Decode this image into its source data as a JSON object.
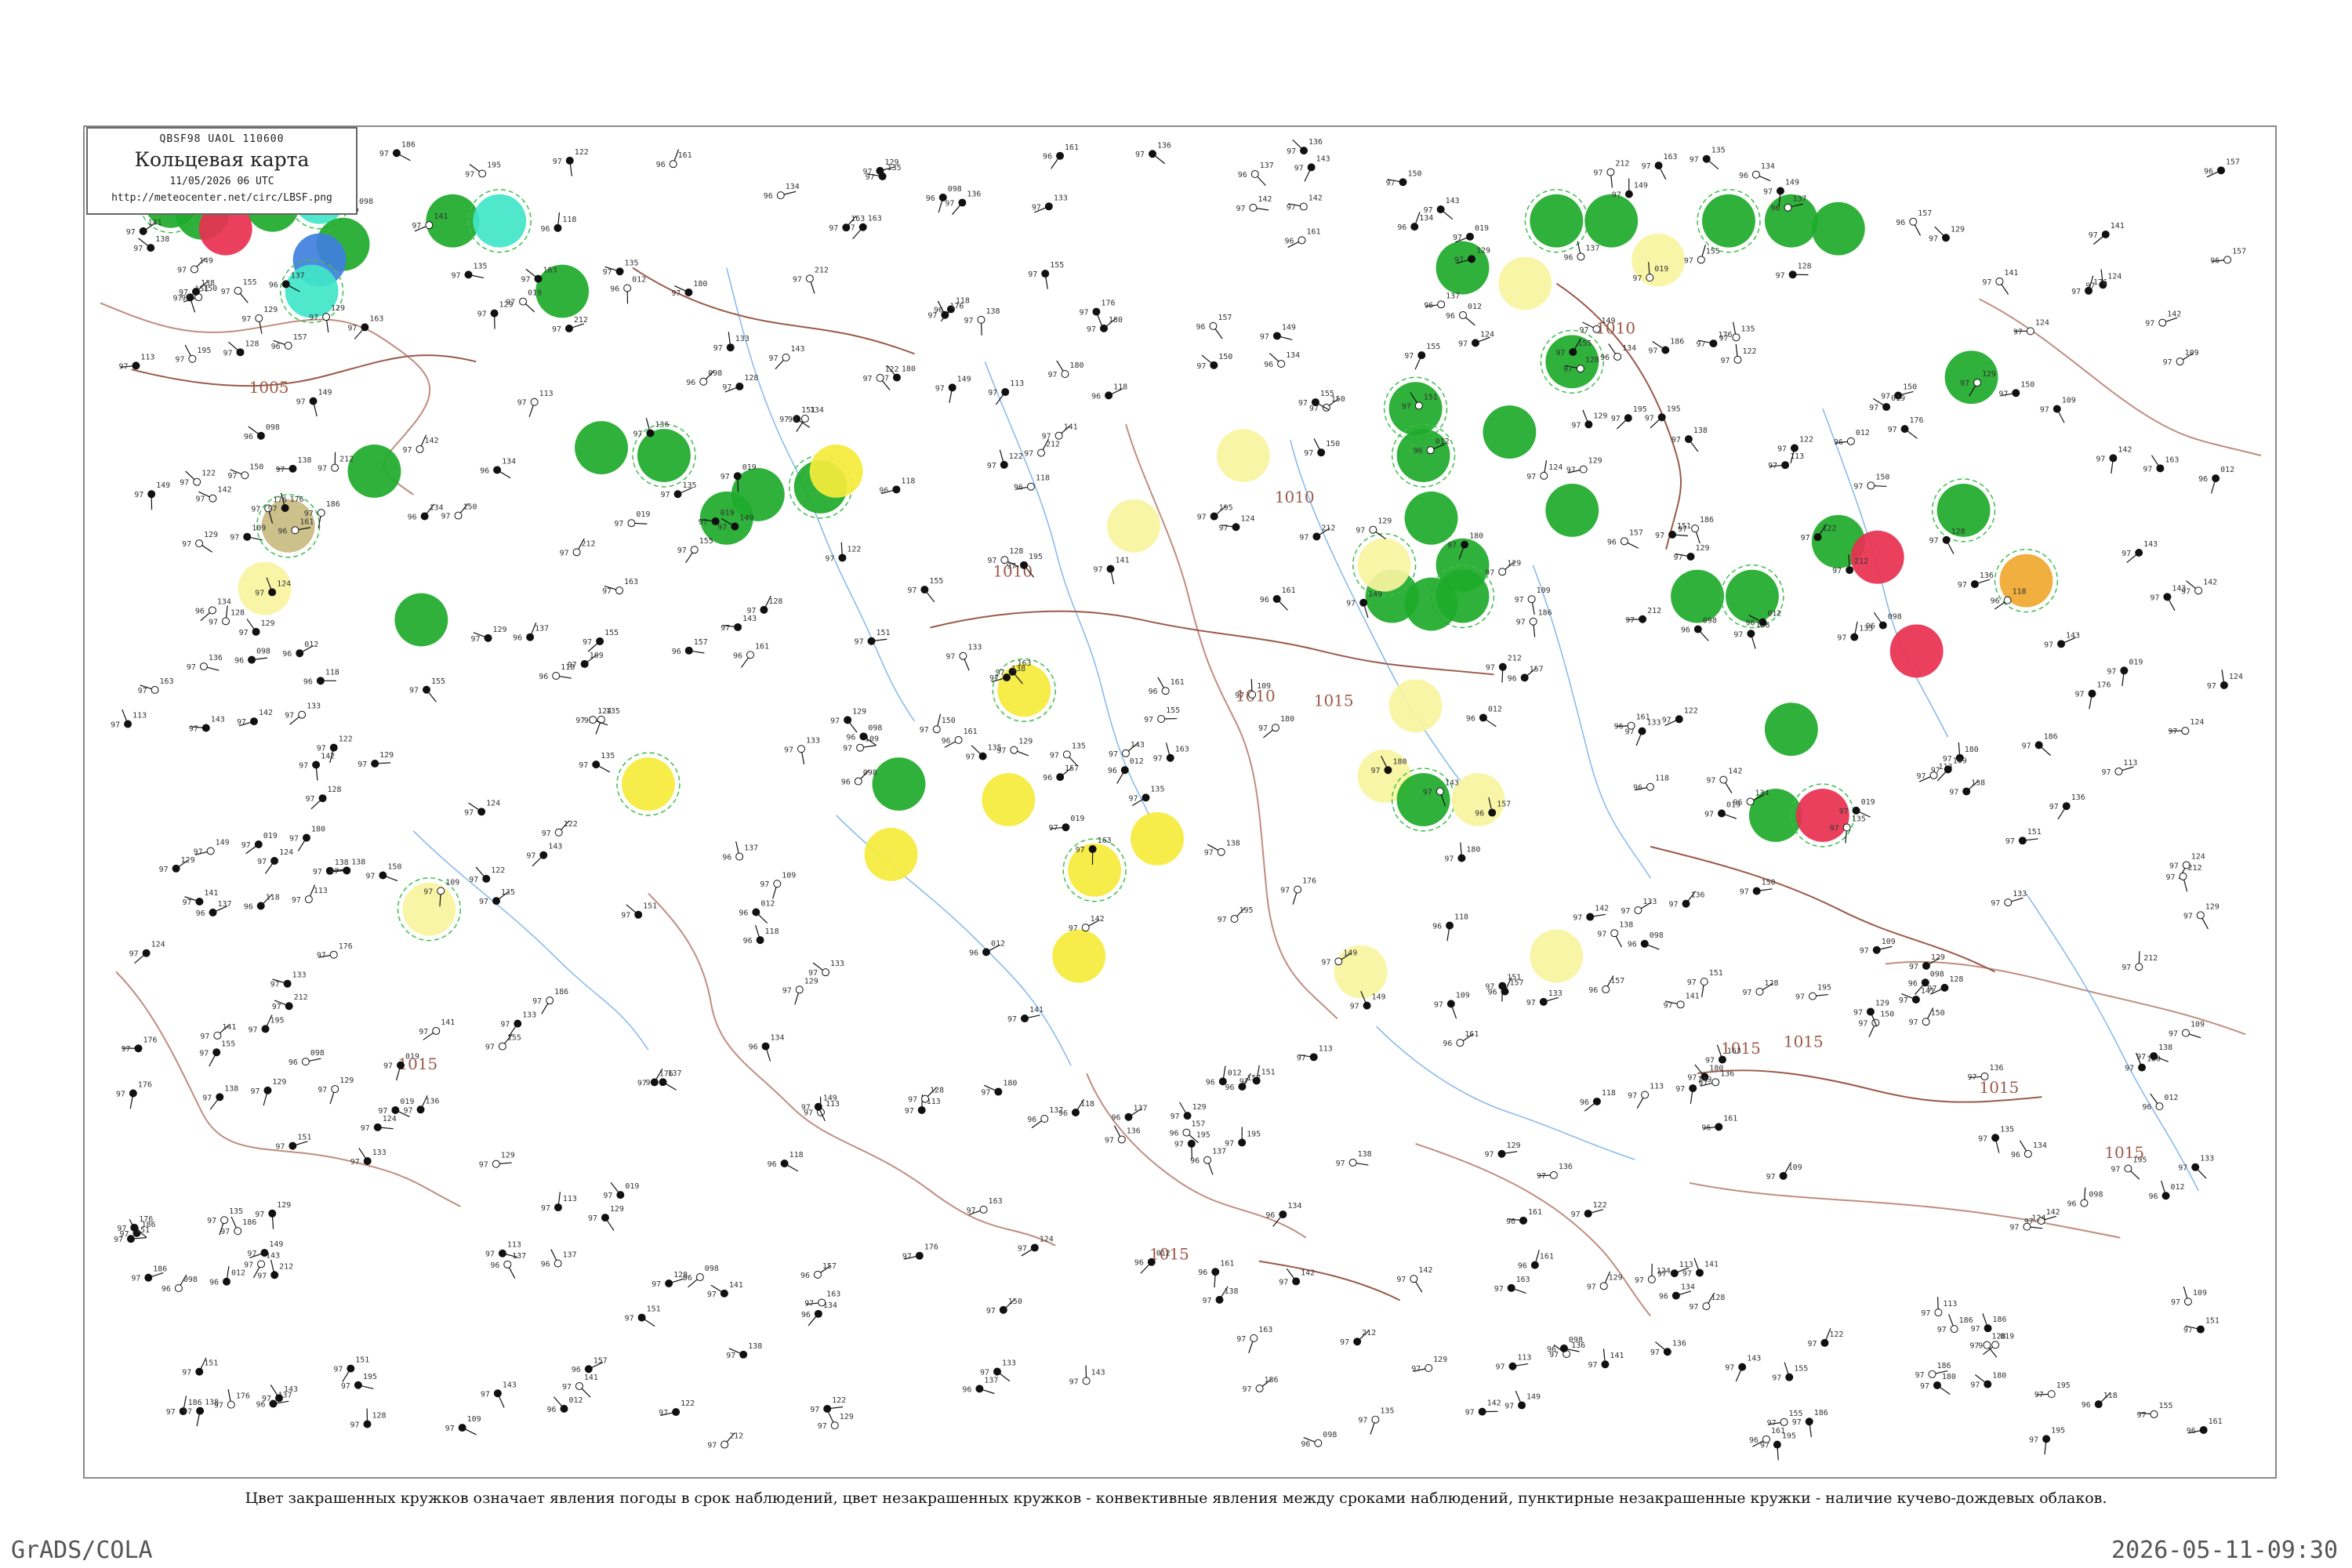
{
  "header": {
    "code_line": "QBSF98  UAOL  110600",
    "title": "Кольцевая карта",
    "datetime": "11/05/2026 06 UTC",
    "url": "http://meteocenter.net/circ/LBSF.png"
  },
  "caption": "Цвет закрашенных кружков означает явления погоды в срок наблюдений, цвет незакрашенных кружков - конвективные явления между сроками наблюдений, пунктирные незакрашенные кружки - наличие кучево-дождевых облаков.",
  "footer": {
    "left": "GrADS/COLA",
    "right": "2026-05-11-09:30"
  },
  "map": {
    "isobar_labels": [
      "1005",
      "1010",
      "1015"
    ],
    "isobar_color": "#9a5a4a",
    "river_color": "#5aa0e6",
    "border_color": "#b07060",
    "station_colors": {
      "rain": "#1eaa2a",
      "fog_haze": "#f5ec3c",
      "dust": "#c8bc80",
      "thunderstorm": "#e83050",
      "snow": "#3f7fe0",
      "drizzle": "#40e6c8",
      "light": "#f8f4a0",
      "smoke": "#f0a830",
      "cb_ring": "#3cbf4c"
    }
  },
  "stations": [
    {
      "v": "97",
      "p": "019"
    },
    {
      "v": "97",
      "p": "124"
    },
    {
      "v": "96",
      "p": "012"
    },
    {
      "v": "97",
      "p": "149"
    },
    {
      "v": "97",
      "p": "129"
    },
    {
      "v": "96",
      "p": "098"
    },
    {
      "v": "97",
      "p": "113"
    },
    {
      "v": "97",
      "p": "138"
    },
    {
      "v": "97",
      "p": "136"
    },
    {
      "v": "96",
      "p": "118"
    },
    {
      "v": "97",
      "p": "150"
    },
    {
      "v": "97",
      "p": "133"
    },
    {
      "v": "96",
      "p": "137"
    },
    {
      "v": "97",
      "p": "122"
    },
    {
      "v": "97",
      "p": "142"
    },
    {
      "v": "97",
      "p": "155"
    },
    {
      "v": "96",
      "p": "161"
    },
    {
      "v": "97",
      "p": "143"
    },
    {
      "v": "97",
      "p": "151"
    },
    {
      "v": "97",
      "p": "109"
    },
    {
      "v": "97",
      "p": "176"
    },
    {
      "v": "96",
      "p": "157"
    },
    {
      "v": "97",
      "p": "129"
    },
    {
      "v": "97",
      "p": "186"
    },
    {
      "v": "97",
      "p": "128"
    },
    {
      "v": "97",
      "p": "135"
    },
    {
      "v": "96",
      "p": "134"
    },
    {
      "v": "97",
      "p": "195"
    },
    {
      "v": "97",
      "p": "163"
    },
    {
      "v": "97",
      "p": "180"
    },
    {
      "v": "97",
      "p": "141"
    },
    {
      "v": "97",
      "p": "212"
    }
  ]
}
